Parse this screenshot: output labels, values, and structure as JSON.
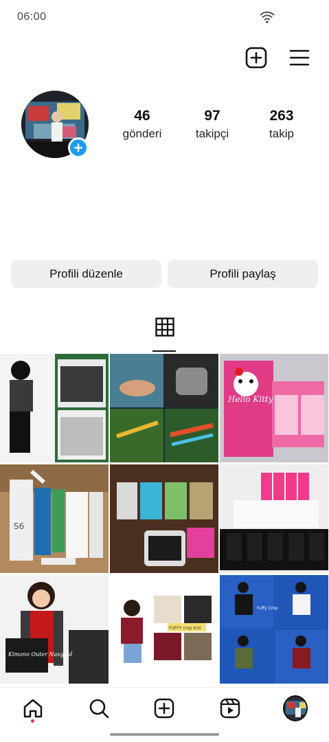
{
  "status_bar": {
    "time": "06:00",
    "wifi_icon": "wifi-icon"
  },
  "header": {
    "new_post_icon": "plus-square-icon",
    "menu_icon": "hamburger-menu-icon"
  },
  "profile": {
    "avatar_add_icon": "plus-circle-icon",
    "stats": [
      {
        "count": "46",
        "label": "gönderi"
      },
      {
        "count": "97",
        "label": "takipçi"
      },
      {
        "count": "263",
        "label": "takip"
      }
    ],
    "buttons": {
      "edit": "Profili düzenle",
      "share": "Profili paylaş"
    }
  },
  "tabs": {
    "grid_icon": "grid-icon"
  },
  "posts": {
    "items": [
      {
        "caption": ""
      },
      {
        "caption": ""
      },
      {
        "caption": "Hello Kitty"
      },
      {
        "caption": "S6"
      },
      {
        "caption": ""
      },
      {
        "caption": ""
      },
      {
        "caption": "Kimono Outer Navgaid"
      },
      {
        "caption": "FUFFY crop knit"
      },
      {
        "caption": "Fuffy Crop"
      }
    ]
  },
  "bottom_nav": {
    "icons": [
      "home-icon",
      "search-icon",
      "create-icon",
      "reels-icon",
      "profile-avatar"
    ]
  },
  "colors": {
    "accent_blue": "#1d9bf0",
    "button_bg": "#efefef",
    "notification_red": "#e8344a"
  }
}
